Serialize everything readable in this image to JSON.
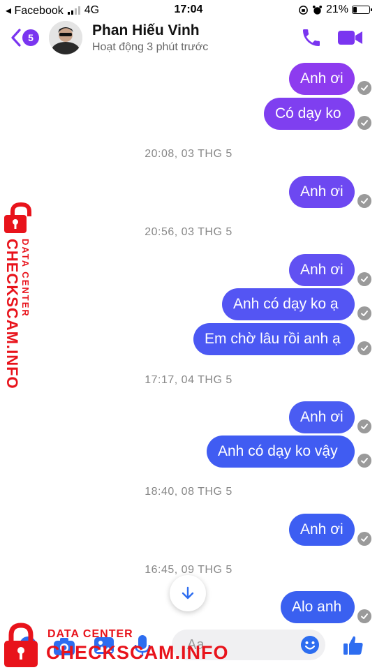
{
  "status_bar": {
    "carrier": "◂ Facebook",
    "network": "4G",
    "time": "17:04",
    "battery": "21%"
  },
  "header": {
    "back_count": "5",
    "name": "Phan Hiếu Vinh",
    "activity": "Hoạt động 3 phút trước"
  },
  "colors": {
    "accent": "#7a35f0",
    "bubble_purple": "#8d3bef",
    "bubble_blue": "#3d5bf2",
    "seen": "#9a9a9a",
    "brand_red": "#e8131b"
  },
  "messages": [
    {
      "text": "Anh ơi"
    },
    {
      "text": "Có dạy ko"
    },
    {
      "timestamp": "20:08, 03 THG 5"
    },
    {
      "text": "Anh ơi"
    },
    {
      "timestamp": "20:56, 03 THG 5"
    },
    {
      "text": "Anh ơi"
    },
    {
      "text": "Anh có dạy ko ạ"
    },
    {
      "text": "Em chờ lâu rồi anh ạ"
    },
    {
      "timestamp": "17:17, 04 THG 5"
    },
    {
      "text": "Anh ơi"
    },
    {
      "text": "Anh có dạy ko vậy"
    },
    {
      "timestamp": "18:40, 08 THG 5"
    },
    {
      "text": "Anh ơi"
    },
    {
      "timestamp": "16:45, 09 THG 5"
    },
    {
      "text": "Alo anh"
    }
  ],
  "composer": {
    "placeholder": "Aa"
  },
  "watermark": {
    "line1": "DATA CENTER",
    "line2": "CHECKSCAM.INFO"
  },
  "icons": [
    "back-chevron-icon",
    "phone-icon",
    "video-call-icon",
    "seen-check-icon",
    "arrow-down-icon",
    "camera-icon",
    "gallery-icon",
    "microphone-icon",
    "emoji-icon",
    "thumbs-up-icon",
    "lock-logo-icon"
  ]
}
